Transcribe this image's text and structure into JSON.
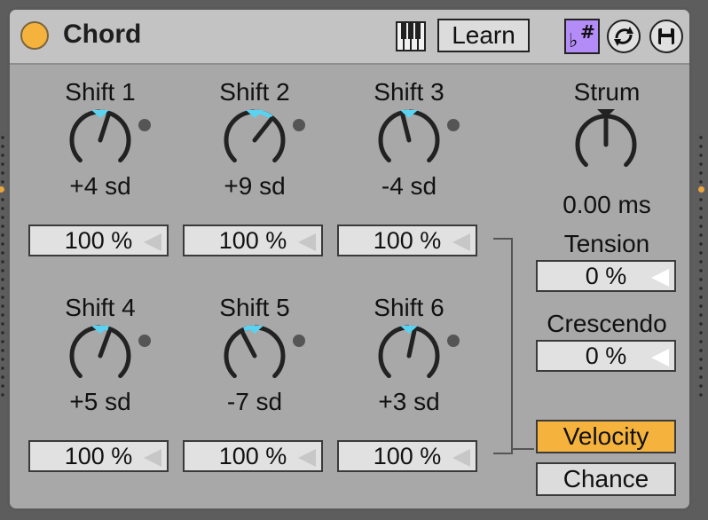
{
  "device": {
    "title": "Chord",
    "learn_label": "Learn",
    "accent": "#f5b33d",
    "sharp_flat_color": "#b48cf7",
    "indicator_color": "#5bd3f0"
  },
  "shifts": [
    {
      "label": "Shift 1",
      "value": "+4 sd",
      "amount": "100 %"
    },
    {
      "label": "Shift 2",
      "value": "+9 sd",
      "amount": "100 %"
    },
    {
      "label": "Shift 3",
      "value": "-4 sd",
      "amount": "100 %"
    },
    {
      "label": "Shift 4",
      "value": "+5 sd",
      "amount": "100 %"
    },
    {
      "label": "Shift 5",
      "value": "-7 sd",
      "amount": "100 %"
    },
    {
      "label": "Shift 6",
      "value": "+3 sd",
      "amount": "100 %"
    }
  ],
  "strum": {
    "label": "Strum",
    "value": "0.00 ms"
  },
  "tension": {
    "label": "Tension",
    "value": "0 %"
  },
  "crescendo": {
    "label": "Crescendo",
    "value": "0 %"
  },
  "modes": {
    "velocity": "Velocity",
    "chance": "Chance",
    "active": "Velocity",
    "active_color": "#f5b33d"
  }
}
